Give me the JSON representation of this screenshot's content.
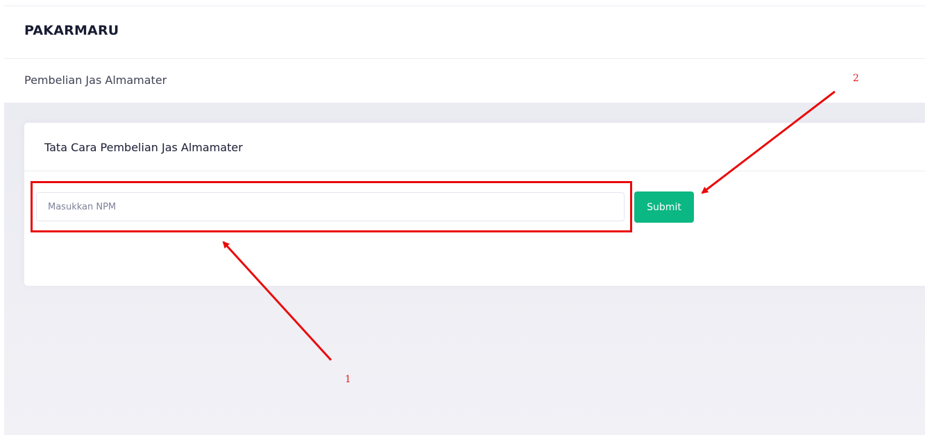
{
  "app": {
    "brand": "PAKARMARU"
  },
  "subheader": {
    "title": "Pembelian Jas Almamater"
  },
  "card": {
    "title": "Tata Cara Pembelian Jas Almamater",
    "npm_input": {
      "placeholder": "Masukkan NPM",
      "value": ""
    },
    "submit_label": "Submit"
  },
  "annotations": {
    "callout_1": "1",
    "callout_2": "2"
  },
  "colors": {
    "submit_button": "#0bb783",
    "annotation": "#ea0a0a",
    "content_background": "#ebebf2"
  }
}
